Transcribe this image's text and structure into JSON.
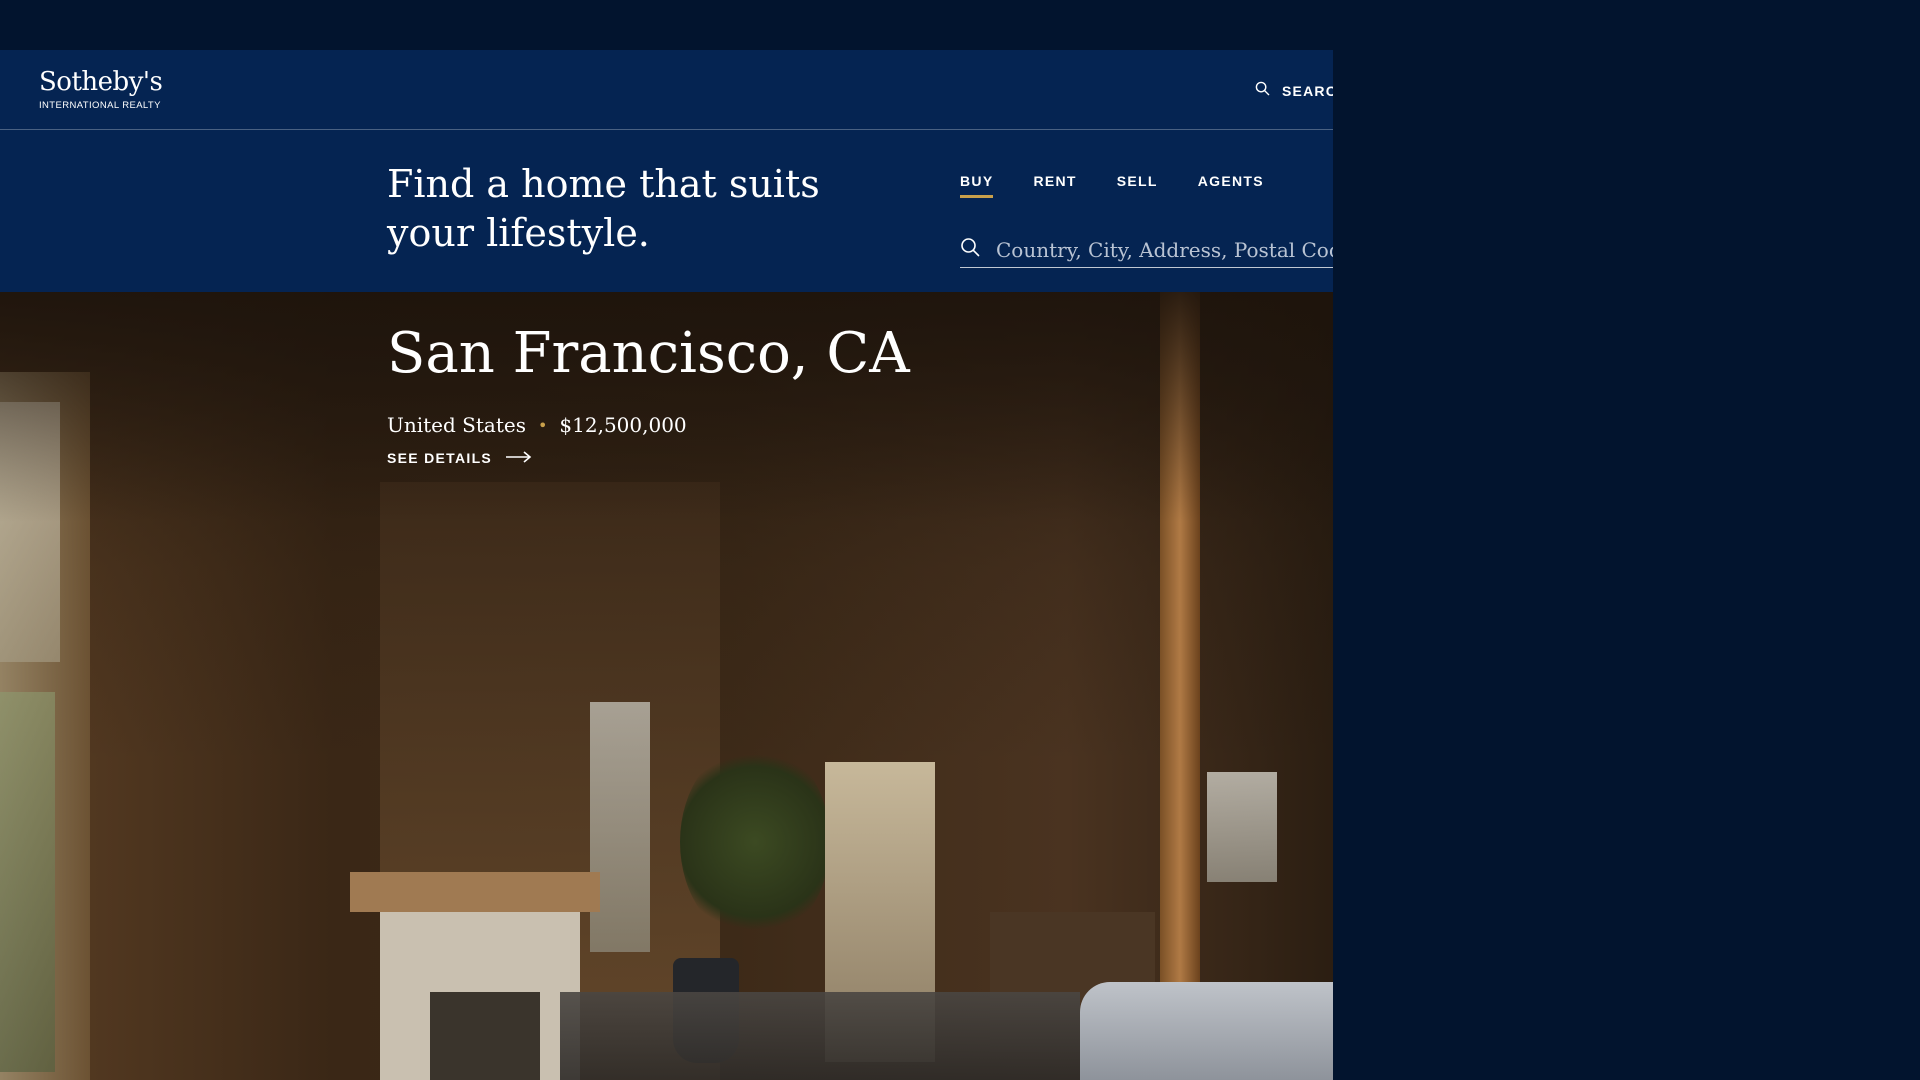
{
  "brand": {
    "name": "Sotheby's",
    "subtitle": "INTERNATIONAL REALTY"
  },
  "header": {
    "search_label": "SEARCH",
    "search_icon": "search-icon"
  },
  "hero": {
    "tagline": "Find a home that suits your lifestyle.",
    "tabs": [
      {
        "label": "BUY",
        "active": true
      },
      {
        "label": "RENT",
        "active": false
      },
      {
        "label": "SELL",
        "active": false
      },
      {
        "label": "AGENTS",
        "active": false
      }
    ],
    "search": {
      "placeholder": "Country, City, Address, Postal Code or ID",
      "icon": "search-icon"
    }
  },
  "listing": {
    "title": "San Francisco, CA",
    "country": "United States",
    "separator": "•",
    "price": "$12,500,000",
    "cta": "SEE DETAILS",
    "cta_icon": "arrow-right-icon"
  },
  "colors": {
    "navy": "#052452",
    "page_bg": "#02142e",
    "gold_accent": "#c9a04b"
  }
}
